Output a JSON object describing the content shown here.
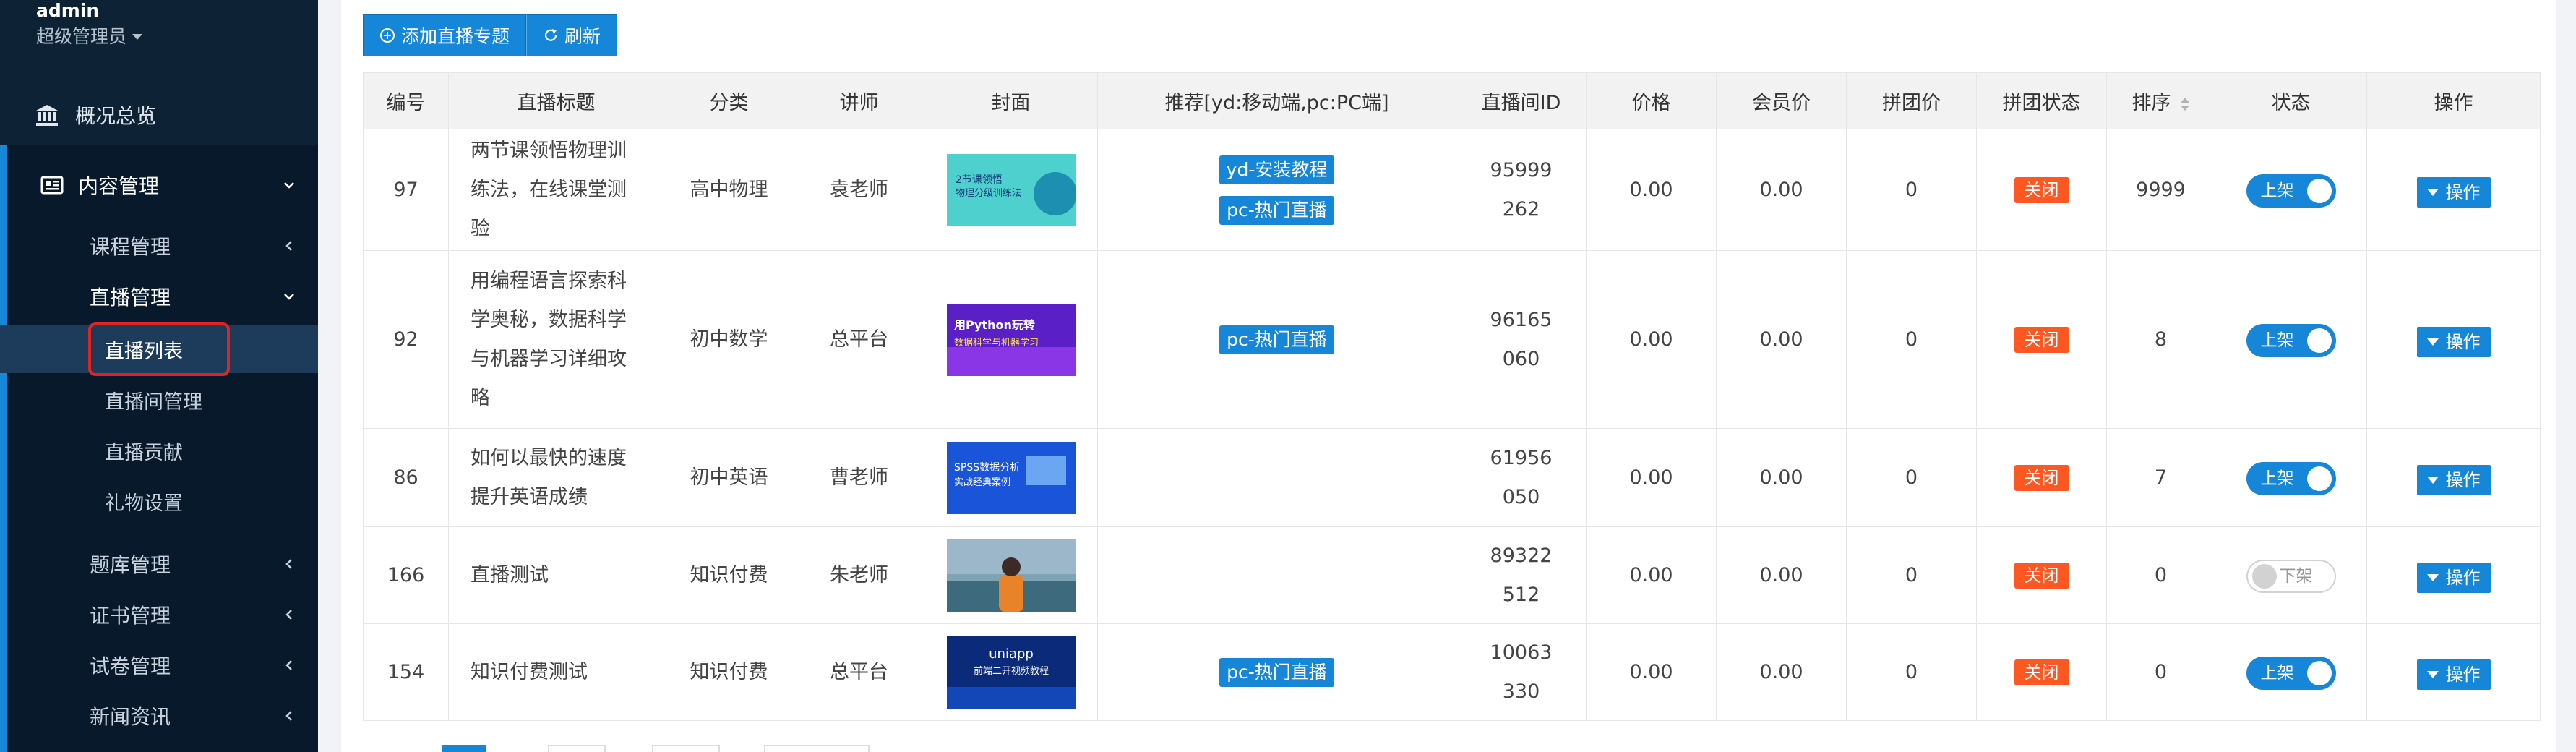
{
  "sidebar": {
    "user": {
      "name": "admin",
      "role": "超级管理员"
    },
    "overview": "概况总览",
    "content_group": "内容管理",
    "items": [
      {
        "label": "课程管理"
      },
      {
        "label": "直播管理"
      },
      {
        "label": "题库管理"
      },
      {
        "label": "证书管理"
      },
      {
        "label": "试卷管理"
      },
      {
        "label": "新闻资讯"
      }
    ],
    "live_sub": [
      {
        "label": "直播列表",
        "active": true
      },
      {
        "label": "直播间管理"
      },
      {
        "label": "直播贡献"
      },
      {
        "label": "礼物设置"
      }
    ]
  },
  "toolbar": {
    "add_label": "添加直播专题",
    "refresh_label": "刷新"
  },
  "table": {
    "headers": {
      "id": "编号",
      "title": "直播标题",
      "category": "分类",
      "teacher": "讲师",
      "cover": "封面",
      "recommend": "推荐[yd:移动端,pc:PC端]",
      "room_id": "直播间ID",
      "price": "价格",
      "member_price": "会员价",
      "group_price": "拼团价",
      "group_status": "拼团状态",
      "sort": "排序",
      "status": "状态",
      "action": "操作"
    },
    "rows": [
      {
        "id": "97",
        "title": "两节课领悟物理训练法，在线课堂测验",
        "category": "高中物理",
        "teacher": "袁老师",
        "cover_text": "2节课领悟\n物理分级训练法",
        "recommend": [
          "yd-安装教程",
          "pc-热门直播"
        ],
        "room_id": "95999262",
        "price": "0.00",
        "member_price": "0.00",
        "group_price": "0",
        "group_status": "关闭",
        "sort": "9999",
        "status": "上架",
        "status_on": true,
        "action": "操作"
      },
      {
        "id": "92",
        "title": "用编程语言探索科学奥秘，数据科学与机器学习详细攻略",
        "category": "初中数学",
        "teacher": "总平台",
        "cover_text": "用Python玩转\n数据科学与机器学习",
        "recommend": [
          "pc-热门直播"
        ],
        "room_id": "96165060",
        "price": "0.00",
        "member_price": "0.00",
        "group_price": "0",
        "group_status": "关闭",
        "sort": "8",
        "status": "上架",
        "status_on": true,
        "action": "操作"
      },
      {
        "id": "86",
        "title": "如何以最快的速度提升英语成绩",
        "category": "初中英语",
        "teacher": "曹老师",
        "cover_text": "SPSS数据分析\n实战经典案例",
        "recommend": [],
        "room_id": "61956050",
        "price": "0.00",
        "member_price": "0.00",
        "group_price": "0",
        "group_status": "关闭",
        "sort": "7",
        "status": "上架",
        "status_on": true,
        "action": "操作"
      },
      {
        "id": "166",
        "title": "直播测试",
        "category": "知识付费",
        "teacher": "朱老师",
        "cover_text": "",
        "recommend": [],
        "room_id": "89322512",
        "price": "0.00",
        "member_price": "0.00",
        "group_price": "0",
        "group_status": "关闭",
        "sort": "0",
        "status": "下架",
        "status_on": false,
        "action": "操作"
      },
      {
        "id": "154",
        "title": "知识付费测试",
        "category": "知识付费",
        "teacher": "总平台",
        "cover_text": "uniapp\n前端二开视频教程",
        "recommend": [
          "pc-热门直播"
        ],
        "room_id": "10063330",
        "price": "0.00",
        "member_price": "0.00",
        "group_price": "0",
        "group_status": "关闭",
        "sort": "0",
        "status": "上架",
        "status_on": true,
        "action": "操作"
      }
    ]
  },
  "colors": {
    "primary": "#1687d8",
    "danger": "#ff5722",
    "sidebar": "#0e2236"
  }
}
